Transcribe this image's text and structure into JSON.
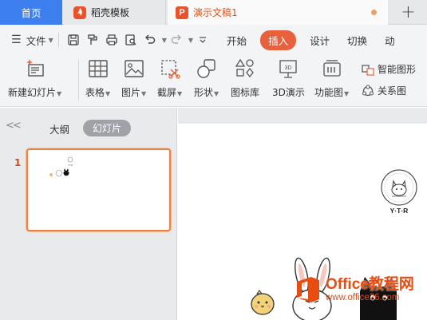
{
  "tabs": {
    "home": "首页",
    "template": "稻壳模板",
    "document": "演示文稿1",
    "new_tab": "+"
  },
  "menu": {
    "file": "文件",
    "ribbon_tabs": [
      "开始",
      "插入",
      "设计",
      "切换",
      "动"
    ]
  },
  "ribbon": {
    "new_slide": "新建幻灯片",
    "table": "表格",
    "picture": "图片",
    "screenshot": "截屏",
    "shape": "形状",
    "icon_library": "图标库",
    "3d_presentation": "3D演示",
    "function_chart": "功能图",
    "smart_graphic": "智能图形",
    "relationship": "关系图"
  },
  "left_pane": {
    "outline_tab": "大纲",
    "slides_tab": "幻灯片",
    "slide_number": "1"
  },
  "slide": {
    "badge_text": "Y·T·R"
  },
  "watermark": {
    "title": "Office教程网",
    "url": "www.office26.com"
  },
  "colors": {
    "accent_orange": "#e8603c",
    "home_tab_blue": "#3e7ff0",
    "selection_border": "#e8844a"
  }
}
